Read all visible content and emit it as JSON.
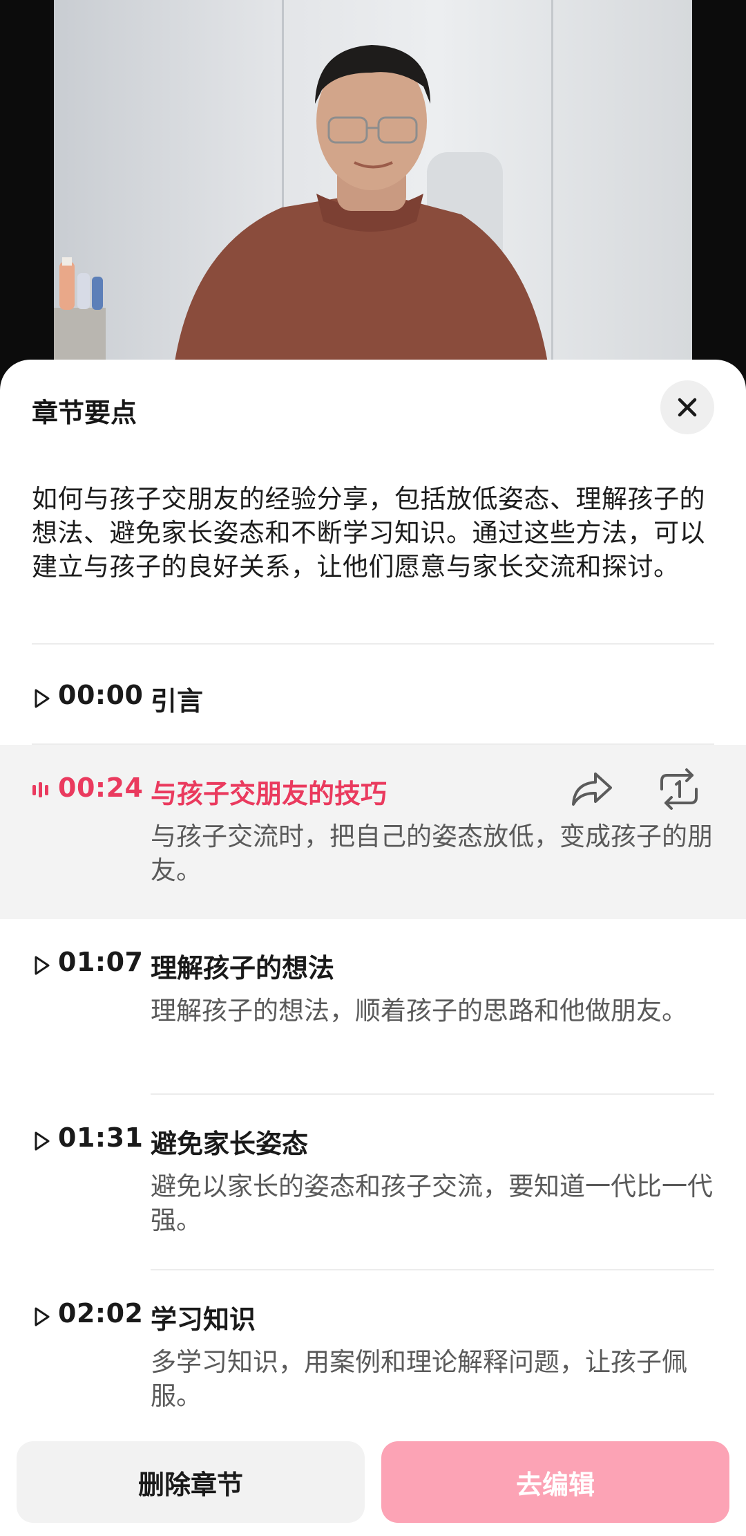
{
  "sheet": {
    "title": "章节要点",
    "summary": "如何与孩子交朋友的经验分享，包括放低姿态、理解孩子的想法、避免家长姿态和不断学习知识。通过这些方法，可以建立与孩子的良好关系，让他们愿意与家长交流和探讨。"
  },
  "chapters": [
    {
      "time": "00:00",
      "title": "引言",
      "desc": ""
    },
    {
      "time": "00:24",
      "title": "与孩子交朋友的技巧",
      "desc": "与孩子交流时，把自己的姿态放低，变成孩子的朋友。",
      "playing": true
    },
    {
      "time": "01:07",
      "title": "理解孩子的想法",
      "desc": "理解孩子的想法，顺着孩子的思路和他做朋友。"
    },
    {
      "time": "01:31",
      "title": "避免家长姿态",
      "desc": "避免以家长的姿态和孩子交流，要知道一代比一代强。"
    },
    {
      "time": "02:02",
      "title": "学习知识",
      "desc": "多学习知识，用案例和理论解释问题，让孩子佩服。"
    }
  ],
  "footer": {
    "delete_label": "删除章节",
    "edit_label": "去编辑"
  },
  "icons": {
    "close": "close-icon",
    "play": "play-triangle-icon",
    "playing": "audio-bars-icon",
    "share": "share-arrow-icon",
    "loop": "repeat-one-icon"
  },
  "colors": {
    "accent": "#ea3a5e",
    "edit_button": "#fca3b5",
    "active_row": "#f3f3f3"
  }
}
